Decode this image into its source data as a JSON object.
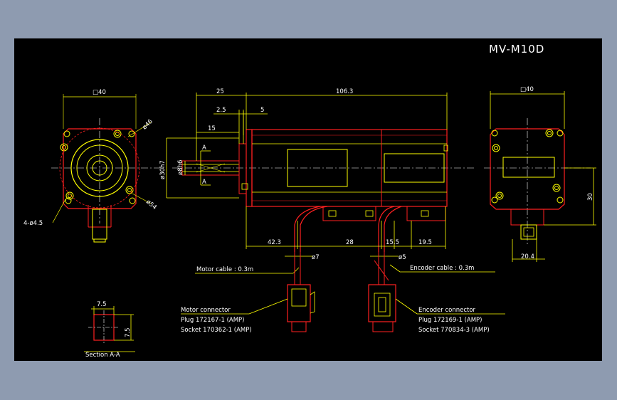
{
  "title": "MV-M10D",
  "dimensions": {
    "front_square": "□40",
    "rear_square": "□40",
    "bolt_circle": "ø46",
    "flange_dia": "ø54",
    "holes": "4-ø4.5",
    "overall_shaft": "25",
    "body_length": "106.3",
    "flange_thick": "2.5",
    "key_offset": "5",
    "key_len": "15",
    "pilot_dia": "ø30h7",
    "shaft_dia": "ø8h6",
    "cable_pos1": "42.3",
    "cable_pos2": "28",
    "cable_pos3": "15.5",
    "cable_pos4": "19.5",
    "motor_cable_dia": "ø7",
    "enc_cable_dia": "ø5",
    "rear_height": "30",
    "rear_width": "20.4",
    "sec_w": "7.5",
    "sec_h": "7.5",
    "label_a": "A"
  },
  "labels": {
    "motor_cable": "Motor cable : 0.3m",
    "encoder_cable": "Encoder cable : 0.3m",
    "motor_conn_title": "Motor connector",
    "motor_conn_plug": "Plug 172167-1 (AMP)",
    "motor_conn_socket": "Socket 170362-1 (AMP)",
    "enc_conn_title": "Encoder connector",
    "enc_conn_plug": "Plug 172169-1 (AMP)",
    "enc_conn_socket": "Socket 770834-3 (AMP)",
    "section": "Section A-A"
  },
  "colors": {
    "outline": "#ff2020",
    "dimension": "#ffff00",
    "text": "#ffffff",
    "background": "#000000"
  }
}
